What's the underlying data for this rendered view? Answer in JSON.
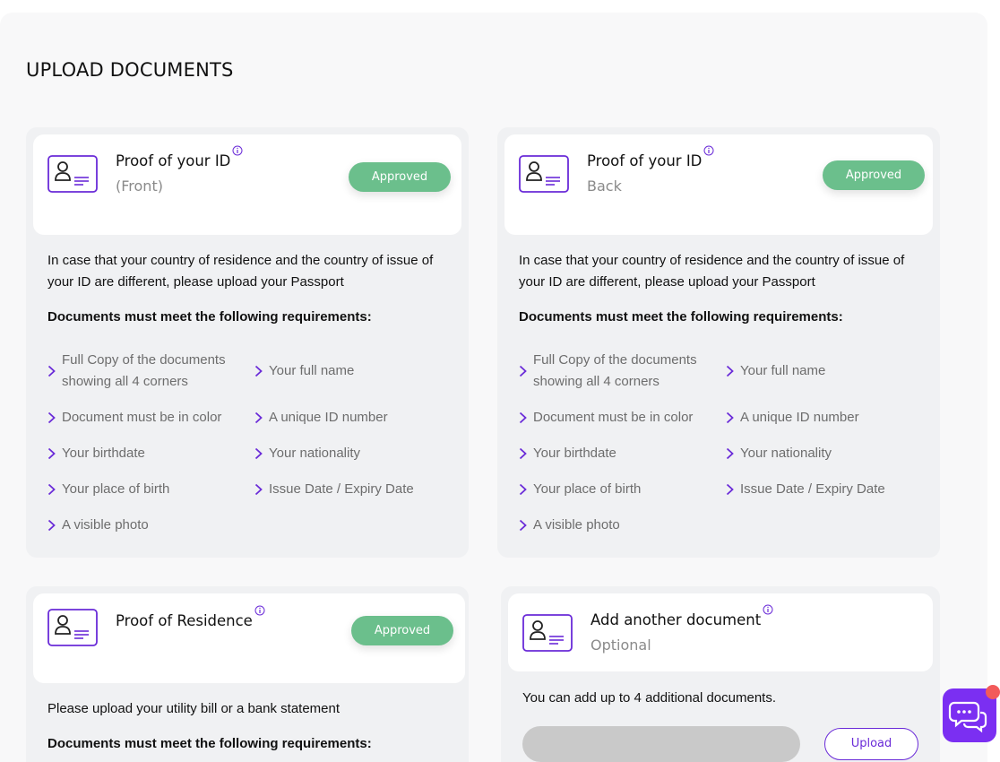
{
  "page_title": "UPLOAD DOCUMENTS",
  "colors": {
    "accent": "#6a2bd8",
    "approved": "#6bbf8c",
    "chat": "#7b2ff2"
  },
  "id_front": {
    "title": "Proof of your ID",
    "subtitle": "(Front)",
    "status": "Approved",
    "description": "In case that your country of residence and the country of issue of your ID are different, please upload your Passport",
    "requirements_title": "Documents must meet the following requirements:",
    "requirements": [
      "Full Copy of the documents showing all 4 corners",
      "Your full name",
      "Document must be in color",
      "A unique ID number",
      "Your birthdate",
      "Your nationality",
      "Your place of birth",
      "Issue Date / Expiry Date",
      "A visible photo"
    ]
  },
  "id_back": {
    "title": "Proof of your ID",
    "subtitle": "Back",
    "status": "Approved",
    "description": "In case that your country of residence and the country of issue of your ID are different, please upload your Passport",
    "requirements_title": "Documents must meet the following requirements:",
    "requirements": [
      "Full Copy of the documents showing all 4 corners",
      "Your full name",
      "Document must be in color",
      "A unique ID number",
      "Your birthdate",
      "Your nationality",
      "Your place of birth",
      "Issue Date / Expiry Date",
      "A visible photo"
    ]
  },
  "residence": {
    "title": "Proof of Residence",
    "status": "Approved",
    "description": "Please upload your utility bill or a bank statement",
    "requirements_title": "Documents must meet the following requirements:"
  },
  "additional": {
    "title": "Add another document",
    "subtitle": "Optional",
    "description": "You can add up to 4 additional documents.",
    "upload_label": "Upload"
  },
  "icons": {
    "document": "id-card-icon",
    "info": "info-icon",
    "chevron": "chevron-right-icon",
    "chat": "chat-bubbles-icon"
  }
}
